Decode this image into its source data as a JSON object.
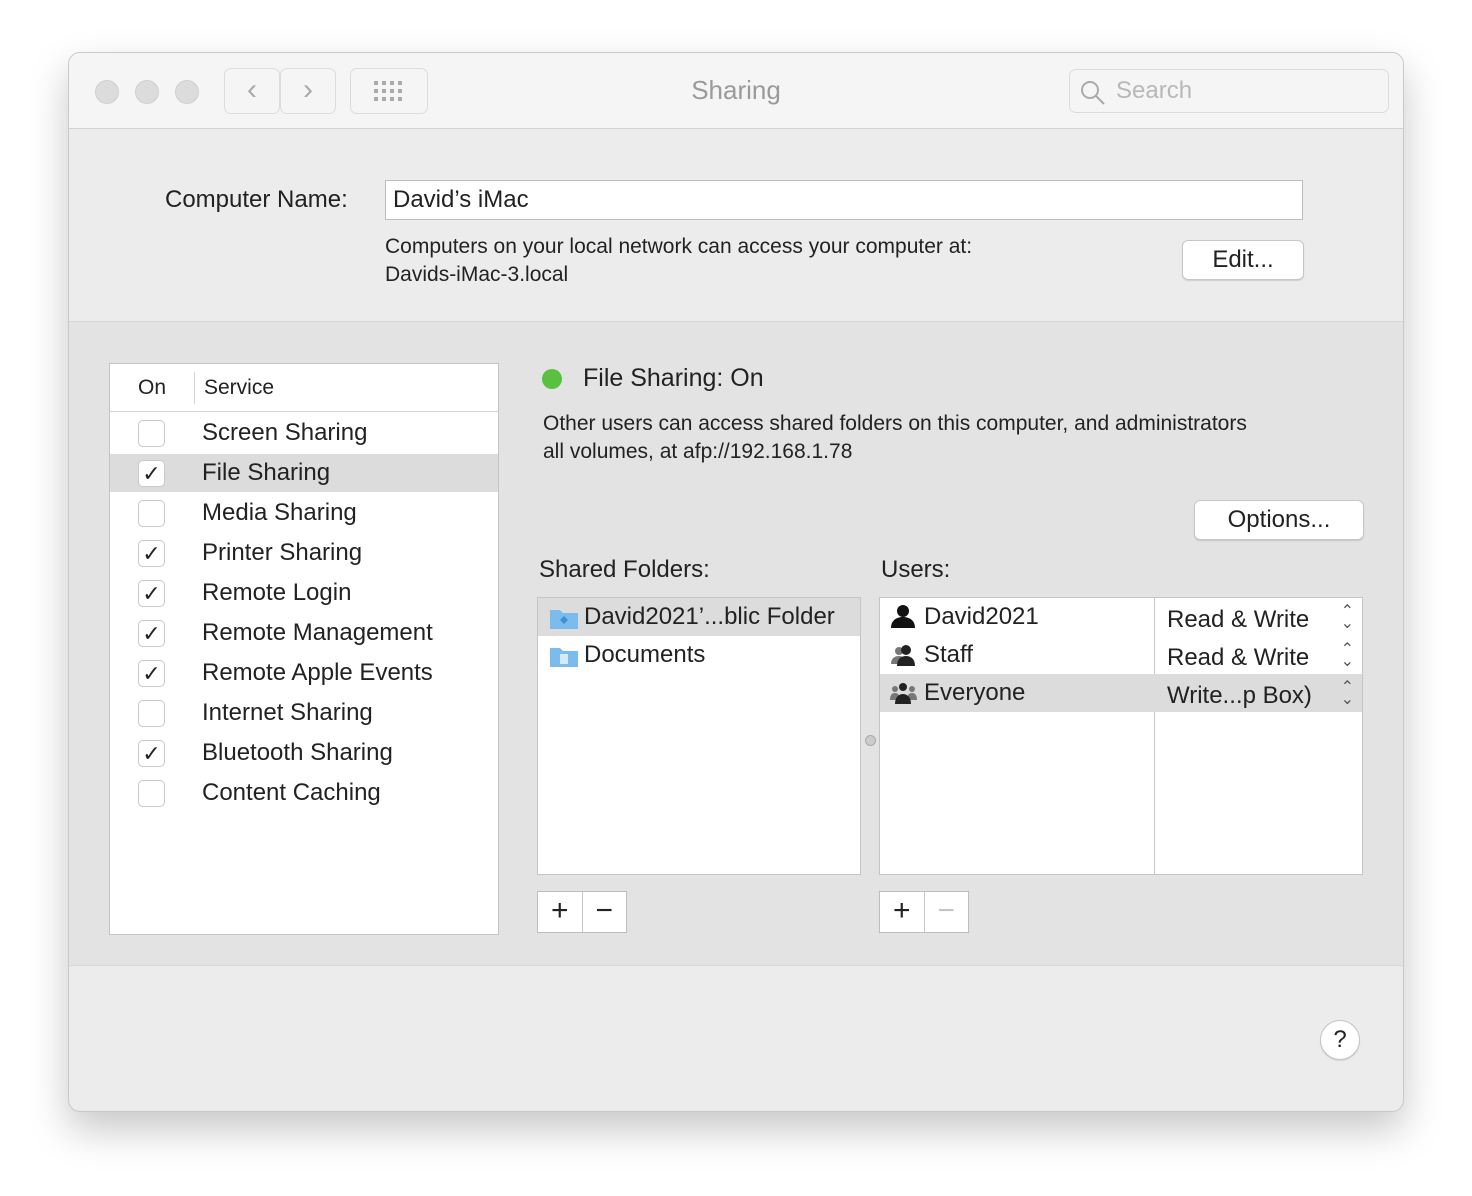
{
  "window": {
    "title": "Sharing",
    "search_placeholder": "Search"
  },
  "computer_name": {
    "label": "Computer Name:",
    "value": "David’s iMac",
    "info": "Computers on your local network can access your computer at:",
    "hostname": "Davids-iMac-3.local",
    "edit_label": "Edit..."
  },
  "services": {
    "col_on": "On",
    "col_service": "Service",
    "items": [
      {
        "label": "Screen Sharing",
        "on": false
      },
      {
        "label": "File Sharing",
        "on": true,
        "selected": true
      },
      {
        "label": "Media Sharing",
        "on": false
      },
      {
        "label": "Printer Sharing",
        "on": true
      },
      {
        "label": "Remote Login",
        "on": true
      },
      {
        "label": "Remote Management",
        "on": true
      },
      {
        "label": "Remote Apple Events",
        "on": true
      },
      {
        "label": "Internet Sharing",
        "on": false
      },
      {
        "label": "Bluetooth Sharing",
        "on": true
      },
      {
        "label": "Content Caching",
        "on": false
      }
    ]
  },
  "detail": {
    "status": "File Sharing: On",
    "status_color": "#5ac03f",
    "description_1": "Other users can access shared folders on this computer, and administrators",
    "description_2": "all volumes, at afp://192.168.1.78",
    "options_label": "Options...",
    "shared_folders_label": "Shared Folders:",
    "users_label": "Users:",
    "folders": [
      "David2021’...blic Folder",
      "Documents"
    ],
    "users": [
      {
        "name": "David2021",
        "perm": "Read & Write"
      },
      {
        "name": "Staff",
        "perm": "Read & Write"
      },
      {
        "name": "Everyone",
        "perm": "Write...p Box)"
      }
    ],
    "plus": "+",
    "minus": "−"
  },
  "help": "?"
}
